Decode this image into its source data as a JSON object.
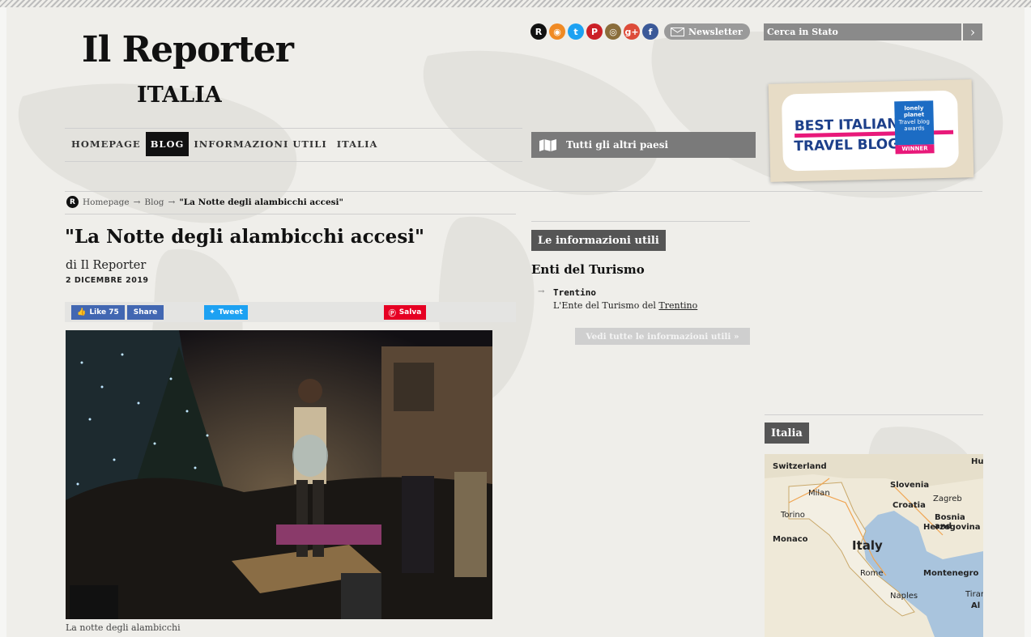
{
  "site": {
    "logo_title": "Il Reporter",
    "logo_subtitle": "ITALIA"
  },
  "social": {
    "icons": [
      {
        "name": "reporter-icon",
        "glyph": "R",
        "color": "#111111"
      },
      {
        "name": "rss-icon",
        "glyph": "◉",
        "color": "#f08a24"
      },
      {
        "name": "twitter-icon",
        "glyph": "t",
        "color": "#1da1f2"
      },
      {
        "name": "pinterest-icon",
        "glyph": "P",
        "color": "#cb2027"
      },
      {
        "name": "instagram-icon",
        "glyph": "◎",
        "color": "#8a6d3b"
      },
      {
        "name": "google-plus-icon",
        "glyph": "g+",
        "color": "#dd4b39"
      },
      {
        "name": "facebook-icon",
        "glyph": "f",
        "color": "#3b5998"
      }
    ],
    "newsletter_label": "Newsletter"
  },
  "search": {
    "placeholder": "Cerca in Stato"
  },
  "nav": {
    "items": [
      "HOMEPAGE",
      "BLOG",
      "INFORMAZIONI UTILI",
      "ITALIA"
    ],
    "active": "BLOG",
    "countries_label": "Tutti gli altri paesi"
  },
  "badge": {
    "line1": "BEST ITALIAN",
    "line2": "TRAVEL BLOG",
    "brand": "lonely planet",
    "award1": "Travel blog",
    "award2": "awards",
    "winner": "WINNER"
  },
  "breadcrumb": {
    "home": "Homepage",
    "section": "Blog",
    "current": "\"La Notte degli alambicchi accesi\"",
    "separator": "→"
  },
  "article": {
    "title": "\"La Notte degli alambicchi accesi\"",
    "author": "di Il Reporter",
    "date": "2 DICEMBRE 2019",
    "share": {
      "like_label": "Like 75",
      "share_label": "Share",
      "tweet_label": "Tweet",
      "save_label": "Salva"
    },
    "caption": "La notte degli alambicchi"
  },
  "info": {
    "section_label": "Le informazioni utili",
    "heading": "Enti del Turismo",
    "item_name": "Trentino",
    "item_desc_prefix": "L'Ente del Turismo del ",
    "item_desc_link": "Trentino",
    "more_label": "Vedi tutte le informazioni utili »"
  },
  "right": {
    "section_label": "Italia",
    "map_labels": [
      "Switzerland",
      "Milan",
      "Torino",
      "Monaco",
      "Italy",
      "Rome",
      "Naples",
      "Slovenia",
      "Zagreb",
      "Croatia",
      "Bosnia and",
      "Herzegovina",
      "Montenegro",
      "Tiran",
      "Hu",
      "Al"
    ]
  },
  "colors": {
    "page_bg": "#efeeea",
    "dark_tag": "#555555",
    "nav_active": "#111111",
    "facebook": "#4267b2",
    "twitter": "#1da1f2",
    "pinterest": "#e60023",
    "badge_blue": "#1c3f8a",
    "badge_pink": "#e8197a"
  }
}
